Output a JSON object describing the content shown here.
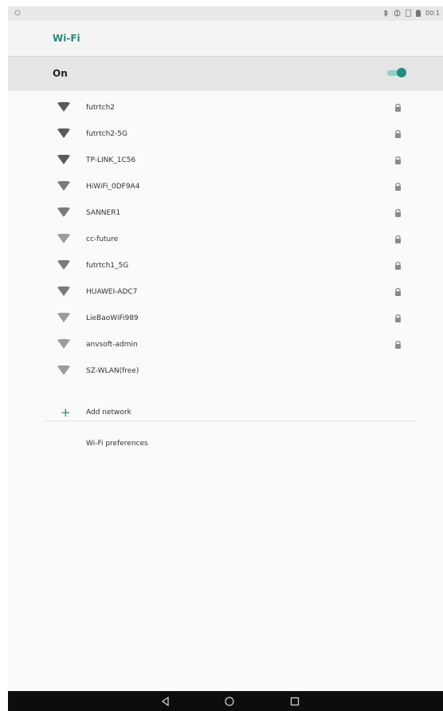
{
  "status_bar": {
    "time": "00:1",
    "icons": [
      "bluetooth-icon",
      "data-icon",
      "battery-saver-icon",
      "battery-icon"
    ]
  },
  "header": {
    "title": "Wi-Fi"
  },
  "wifi_toggle": {
    "label": "On",
    "state": "on"
  },
  "networks": [
    {
      "name": "futrtch2",
      "secured": true,
      "strength": 4
    },
    {
      "name": "futrtch2-5G",
      "secured": true,
      "strength": 4
    },
    {
      "name": "TP-LINK_1C56",
      "secured": true,
      "strength": 4
    },
    {
      "name": "HiWiFi_0DF9A4",
      "secured": true,
      "strength": 3
    },
    {
      "name": "SANNER1",
      "secured": true,
      "strength": 3
    },
    {
      "name": "cc-future",
      "secured": true,
      "strength": 2
    },
    {
      "name": "futrtch1_5G",
      "secured": true,
      "strength": 3
    },
    {
      "name": "HUAWEI-ADC7",
      "secured": true,
      "strength": 3
    },
    {
      "name": "LieBaoWiFi989",
      "secured": true,
      "strength": 2
    },
    {
      "name": "anvsoft-admin",
      "secured": true,
      "strength": 2
    },
    {
      "name": "SZ-WLAN(free)",
      "secured": false,
      "strength": 2
    }
  ],
  "add_network": {
    "label": "Add network",
    "icon": "plus-icon"
  },
  "preferences": {
    "label": "Wi-Fi preferences"
  },
  "nav_bar": {
    "buttons": [
      "back-icon",
      "home-icon",
      "recents-icon"
    ]
  },
  "colors": {
    "accent": "#1d8f80",
    "accent_light": "#8ed0c6",
    "navbar": "#0d0d0d"
  }
}
